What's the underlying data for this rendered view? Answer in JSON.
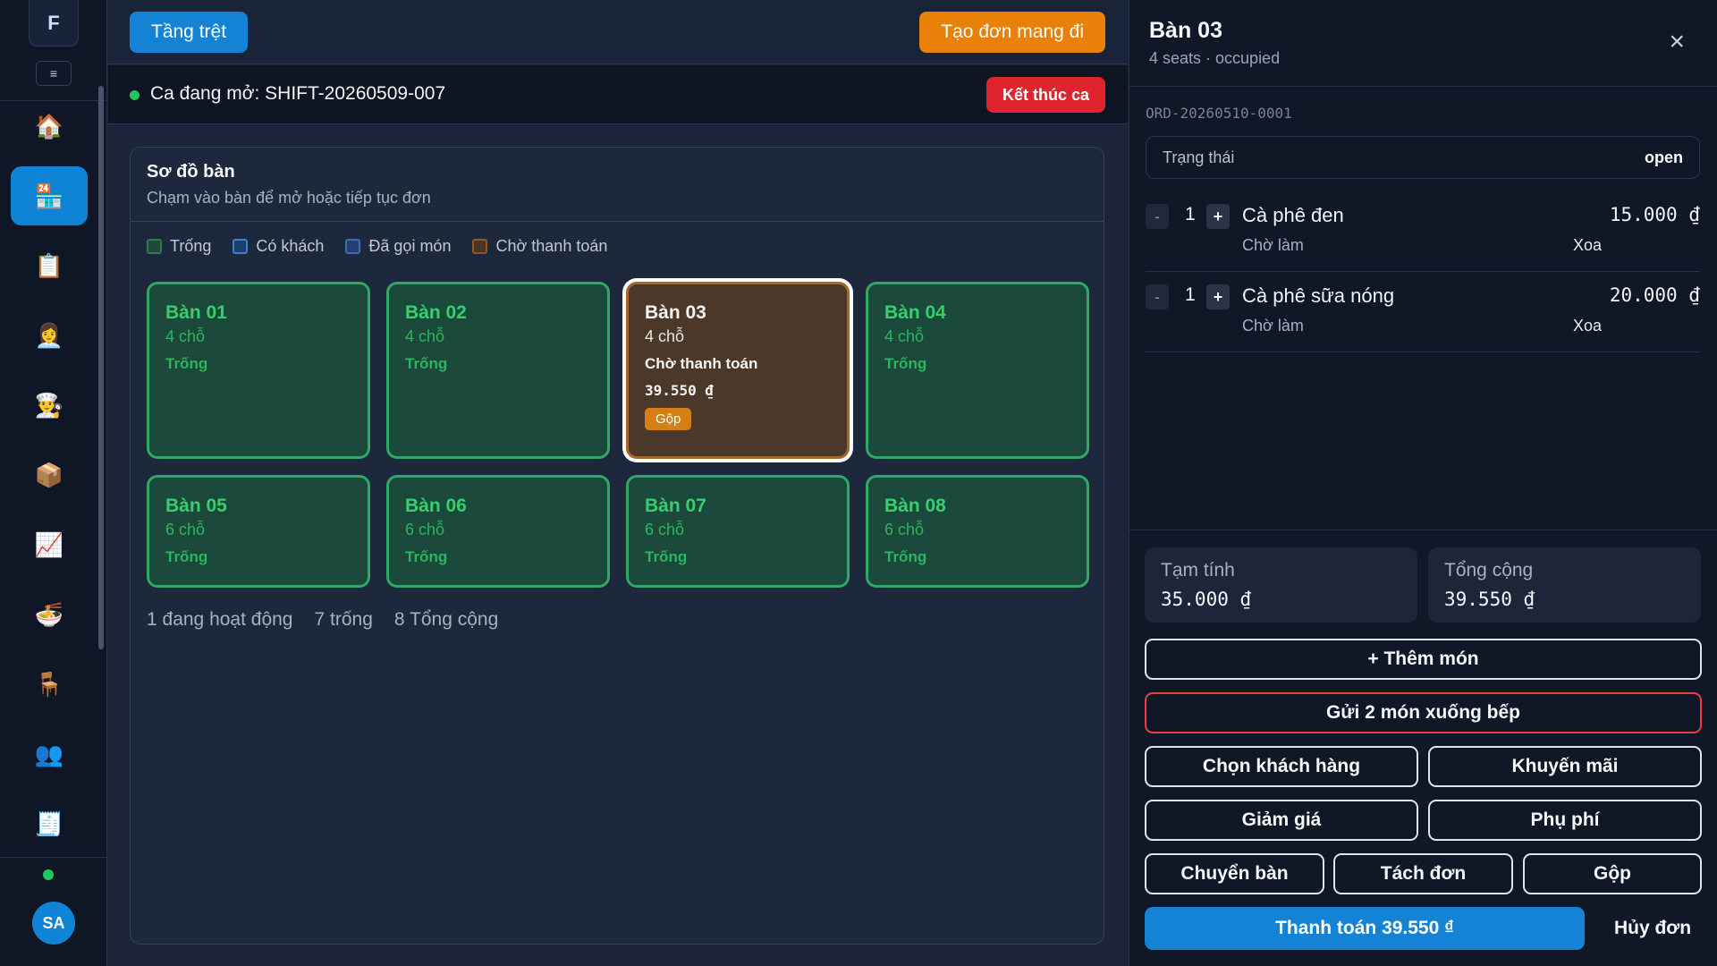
{
  "sidebar": {
    "logo": "F",
    "menu_toggle": "≡",
    "items": [
      {
        "name": "home",
        "icon": "🏠"
      },
      {
        "name": "tables",
        "icon": "🏪"
      },
      {
        "name": "orders",
        "icon": "📋"
      },
      {
        "name": "staff",
        "icon": "👩‍💼"
      },
      {
        "name": "kitchen",
        "icon": "👨‍🍳"
      },
      {
        "name": "inventory",
        "icon": "📦"
      },
      {
        "name": "reports",
        "icon": "📈"
      },
      {
        "name": "menu",
        "icon": "🍜"
      },
      {
        "name": "furniture",
        "icon": "🪑"
      },
      {
        "name": "customers",
        "icon": "👥"
      },
      {
        "name": "receipts",
        "icon": "🧾"
      }
    ],
    "active_item": "tables",
    "user_initials": "SA"
  },
  "topbar": {
    "floor_label": "Tầng trệt",
    "takeaway_label": "Tạo đơn mang đi"
  },
  "shift": {
    "text": "Ca đang mở: SHIFT-20260509-007",
    "end_label": "Kết thúc ca"
  },
  "table_map": {
    "title": "Sơ đồ bàn",
    "subtitle": "Chạm vào bàn để mở hoặc tiếp tục đơn",
    "legend": {
      "empty": "Trống",
      "occupied": "Có khách",
      "ordered": "Đã gọi món",
      "awaiting_payment": "Chờ thanh toán"
    },
    "tables": [
      {
        "name": "Bàn 01",
        "seats": "4 chỗ",
        "status": "Trống"
      },
      {
        "name": "Bàn 02",
        "seats": "4 chỗ",
        "status": "Trống"
      },
      {
        "name": "Bàn 03",
        "seats": "4 chỗ",
        "status": "Chờ thanh toán",
        "amount": "39.550 ₫",
        "badge": "Gộp"
      },
      {
        "name": "Bàn 04",
        "seats": "4 chỗ",
        "status": "Trống"
      },
      {
        "name": "Bàn 05",
        "seats": "6 chỗ",
        "status": "Trống"
      },
      {
        "name": "Bàn 06",
        "seats": "6 chỗ",
        "status": "Trống"
      },
      {
        "name": "Bàn 07",
        "seats": "6 chỗ",
        "status": "Trống"
      },
      {
        "name": "Bàn 08",
        "seats": "6 chỗ",
        "status": "Trống"
      }
    ],
    "stats": {
      "active": "1 đang hoạt động",
      "empty": "7 trống",
      "total": "8 Tổng cộng"
    }
  },
  "panel": {
    "title": "Bàn 03",
    "subtitle": "4 seats · occupied",
    "close_icon": "×",
    "order_id": "ORD-20260510-0001",
    "status_label": "Trạng thái",
    "status_value": "open",
    "items": [
      {
        "qty": "1",
        "name": "Cà phê đen",
        "price": "15.000 ₫",
        "state": "Chờ làm",
        "remove": "Xoa"
      },
      {
        "qty": "1",
        "name": "Cà phê sữa nóng",
        "price": "20.000 ₫",
        "state": "Chờ làm",
        "remove": "Xoa"
      }
    ],
    "qty_minus": "-",
    "qty_plus": "+",
    "subtotal_label": "Tạm tính",
    "subtotal_value": "35.000 ₫",
    "total_label": "Tổng cộng",
    "total_value": "39.550 ₫",
    "actions": {
      "add_item": "+ Thêm món",
      "send_kitchen": "Gửi 2 món xuống bếp",
      "choose_customer": "Chọn khách hàng",
      "promotion": "Khuyến mãi",
      "discount": "Giảm giá",
      "surcharge": "Phụ phí",
      "move_table": "Chuyển bàn",
      "split_order": "Tách đơn",
      "merge": "Gộp",
      "pay": "Thanh toán 39.550 ₫",
      "cancel": "Hủy đơn"
    }
  },
  "colors": {
    "accent": "#1483d6",
    "takeaway": "#e8800a",
    "danger": "#e0242e",
    "table_empty_border": "#2fa866",
    "table_pay_bg": "#4b3828"
  }
}
